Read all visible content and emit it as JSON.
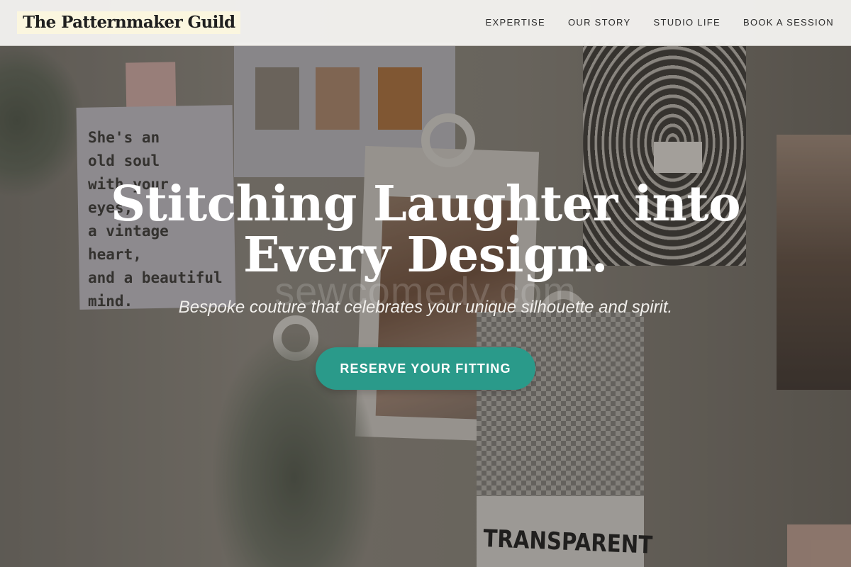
{
  "header": {
    "brand": "The Patternmaker Guild",
    "nav": [
      {
        "label": "EXPERTISE"
      },
      {
        "label": "OUR STORY"
      },
      {
        "label": "STUDIO LIFE"
      },
      {
        "label": "BOOK A SESSION"
      }
    ]
  },
  "hero": {
    "title_line1": "Stitching Laughter into",
    "title_line2": "Every Design.",
    "watermark": "sewcomedy.com",
    "subtitle": "Bespoke couture that celebrates your unique silhouette and spirit.",
    "cta_label": "RESERVE YOUR FITTING"
  },
  "background": {
    "quote_card_text": "She's an\nold soul\nwith your\neyes,\na vintage heart,\nand a beautiful\nmind.",
    "card_label": "TRANSPARENT"
  },
  "colors": {
    "accent": "#2a9a8a",
    "header_bg": "#f6f5f3",
    "brand_highlight": "#fbf6df",
    "hero_text": "#ffffff"
  }
}
